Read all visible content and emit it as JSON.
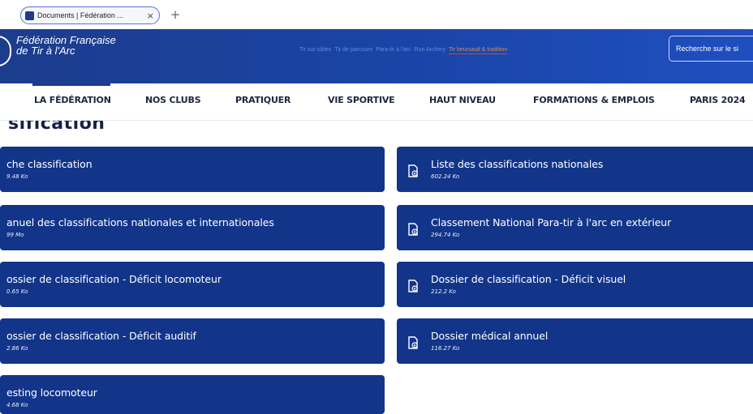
{
  "browser": {
    "tab_title": "Documents | Fédération ...",
    "tab_close": "×",
    "new_tab": "+"
  },
  "banner": {
    "brand_line1": "Fédération Française",
    "brand_line2": "de Tir à l'Arc",
    "top_links": [
      "Tir sur cibles",
      "Tir de parcours",
      "Para-tir à l'arc",
      "Run Archery",
      "Tir beursault & tradition"
    ],
    "search_placeholder": "Recherche sur le si"
  },
  "main_nav": {
    "items": [
      "LA FÉDÉRATION",
      "NOS CLUBS",
      "PRATIQUER",
      "VIE SPORTIVE",
      "HAUT NIVEAU",
      "FORMATIONS & EMPLOIS",
      "PARIS 2024"
    ],
    "active": "LA FÉDÉRATION"
  },
  "page": {
    "heading": "sification"
  },
  "documents": {
    "left": [
      {
        "title": "che classification",
        "size": "9.48 Ko"
      },
      {
        "title": "anuel des classifications nationales et internationales",
        "size": "99 Mo"
      },
      {
        "title": "ossier de classification - Déficit locomoteur",
        "size": "0.65 Ko"
      },
      {
        "title": "ossier de classification - Déficit auditif",
        "size": "2.86 Ko"
      },
      {
        "title": "esting locomoteur",
        "size": "4.68 Ko"
      }
    ],
    "right": [
      {
        "title": "Liste des classifications nationales",
        "size": "602.24 Ko"
      },
      {
        "title": "Classement National Para-tir à l'arc en extérieur",
        "size": "294.74 Ko"
      },
      {
        "title": "Dossier de classification - Déficit visuel",
        "size": "212.2 Ko"
      },
      {
        "title": "Dossier médical annuel",
        "size": "116.27 Ko"
      }
    ]
  },
  "colors": {
    "card_blue": "#12358a",
    "banner_blue": "#1c3c8c",
    "nav_text": "#1e2640"
  },
  "icons": {
    "card_icon": "pdf-document-icon"
  }
}
